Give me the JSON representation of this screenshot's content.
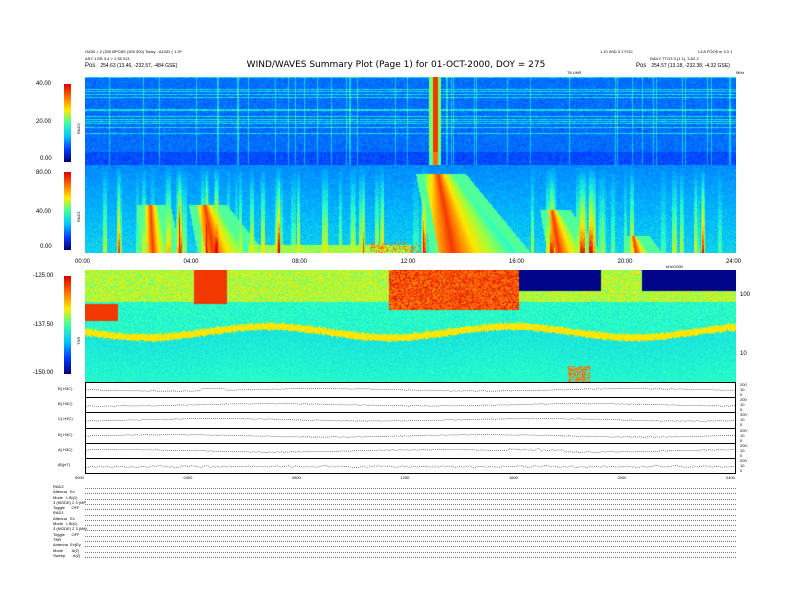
{
  "header": {
    "left_line1": "OA30 > 2 (200 BPCBS (300 300) Tonky - A1032 ( 1 2F",
    "left_line2": "ASY 1 EB 3.4 > 1 35 013",
    "left_line3_label": "Pos",
    "left_line3_value": "254.63 (13.46, -232.57, -484 GSE)",
    "right_line1_a": "1.10 WID 3 1 FOC",
    "right_line1_b": "L3.8 FOO5 m 3 0 1",
    "right_line2": "DAILY TTG3 3 (1 1), 3 A2 2",
    "right_line3_label": "Pos",
    "right_line3_value": "254.57 (13.18, -232.38, -4.32 GSE)",
    "title": "WIND/WAVES Summary Plot (Page 1) for 01-OCT-2000, DOY = 275",
    "tnr_unit": "T8 UNR",
    "mhz_unit": "MHz"
  },
  "panels": {
    "rad2": {
      "label": "RAD2",
      "ticks": [
        "40.00",
        "20.00",
        "0.00"
      ]
    },
    "rad1": {
      "label": "RAD1",
      "ticks": [
        "80.00",
        "40.00",
        "0.00"
      ]
    },
    "tnr": {
      "label": "TNR",
      "ticks": [
        "-125.00",
        "-137.50",
        "-150.00"
      ],
      "right_ticks": [
        "100",
        "10"
      ]
    },
    "tnr_freq_label": "kHz/1000"
  },
  "time_axis_top": [
    "00:00",
    "04:00",
    "08:00",
    "12:00",
    "16:00",
    "20:00",
    "24:00"
  ],
  "time_axis_bottom": [
    "0000",
    "0400",
    "0800",
    "1200",
    "1600",
    "2000",
    "2400"
  ],
  "line_plots": [
    {
      "label": "B(  H3C)",
      "right": [
        "200",
        "10",
        "0"
      ]
    },
    {
      "label": "B(  H3C)",
      "right": [
        "200",
        "10",
        "0"
      ]
    },
    {
      "label": "C(  H3C)",
      "right": [
        "200",
        "10",
        "0"
      ]
    },
    {
      "label": "B(  H3C)",
      "right": [
        "200",
        "10",
        "0"
      ]
    },
    {
      "label": "A(  H3C)",
      "right": [
        "200",
        "10",
        "0"
      ]
    },
    {
      "label": "|B|(nT)",
      "right": [
        "200",
        "10",
        "0"
      ]
    }
  ],
  "params": [
    "RAD2",
    "Attenua   Ex",
    "Mode   LIN(1)",
    "3 (MODE) 2 3 (MP",
    "Toggle      OFF",
    "RAD1",
    "Attenua   Ex",
    "Mode   LIN(1)",
    "3 (MODE) 2 3 (MM",
    "Toggle      OFF",
    "TNR",
    "Antenna  Ex(Ey",
    "Mode        A(2)",
    "Sweep       A(2)"
  ],
  "chart_data": [
    {
      "type": "heatmap",
      "title": "WIND/WAVES Summary Plot (Page 1) for 01-OCT-2000, DOY = 275",
      "ylabel": "RAD2",
      "ylim": [
        0,
        40
      ],
      "x_range": [
        "00:00",
        "24:00"
      ],
      "colorscale": [
        "#000080",
        "#0050ff",
        "#00c8ff",
        "#40ff80",
        "#ffff00",
        "#ff8000",
        "#ff0000"
      ],
      "bursts_hours": [
        12.9
      ]
    },
    {
      "type": "heatmap",
      "ylabel": "RAD1",
      "ylim": [
        0,
        80
      ],
      "x_range": [
        "00:00",
        "24:00"
      ],
      "bursts_hours": [
        2.3,
        4.3,
        12.8,
        17.2,
        20.1
      ]
    },
    {
      "type": "heatmap",
      "ylabel": "TNR",
      "ylim": [
        -150,
        -125
      ],
      "x_range": [
        "00:00",
        "24:00"
      ],
      "bursts_hours": [
        0.3,
        4.5,
        11.5,
        12.6,
        17.9
      ]
    }
  ]
}
